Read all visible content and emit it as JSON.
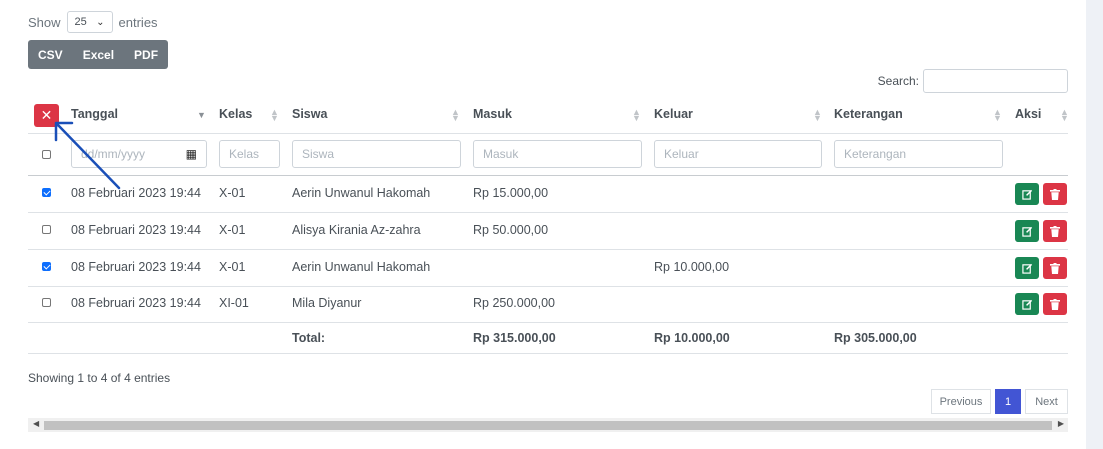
{
  "length_menu": {
    "prefix": "Show",
    "value": "25",
    "suffix": "entries"
  },
  "export_buttons": [
    "CSV",
    "Excel",
    "PDF"
  ],
  "search": {
    "label": "Search:",
    "value": ""
  },
  "table": {
    "columns": [
      "Tanggal",
      "Kelas",
      "Siswa",
      "Masuk",
      "Keluar",
      "Keterangan",
      "Aksi"
    ],
    "filters": {
      "tanggal": "dd/mm/yyyy",
      "kelas": "Kelas",
      "siswa": "Siswa",
      "masuk": "Masuk",
      "keluar": "Keluar",
      "keterangan": "Keterangan"
    },
    "rows": [
      {
        "checked": true,
        "tanggal": "08 Februari 2023 19:44",
        "kelas": "X-01",
        "siswa": "Aerin Unwanul Hakomah",
        "masuk": "Rp 15.000,00",
        "keluar": "",
        "keterangan": ""
      },
      {
        "checked": false,
        "tanggal": "08 Februari 2023 19:44",
        "kelas": "X-01",
        "siswa": "Alisya Kirania Az-zahra",
        "masuk": "Rp 50.000,00",
        "keluar": "",
        "keterangan": ""
      },
      {
        "checked": true,
        "tanggal": "08 Februari 2023 19:44",
        "kelas": "X-01",
        "siswa": "Aerin Unwanul Hakomah",
        "masuk": "",
        "keluar": "Rp 10.000,00",
        "keterangan": ""
      },
      {
        "checked": false,
        "tanggal": "08 Februari 2023 19:44",
        "kelas": "XI-01",
        "siswa": "Mila Diyanur",
        "masuk": "Rp 250.000,00",
        "keluar": "",
        "keterangan": ""
      }
    ],
    "footer": {
      "label": "Total:",
      "masuk": "Rp 315.000,00",
      "keluar": "Rp 10.000,00",
      "keterangan": "Rp 305.000,00"
    }
  },
  "info": "Showing 1 to 4 of 4 entries",
  "pagination": {
    "previous": "Previous",
    "current": "1",
    "next": "Next"
  },
  "colors": {
    "danger": "#dc3545",
    "success": "#198754",
    "primary": "#4255d4",
    "annotation_arrow": "#1a4fb8"
  }
}
